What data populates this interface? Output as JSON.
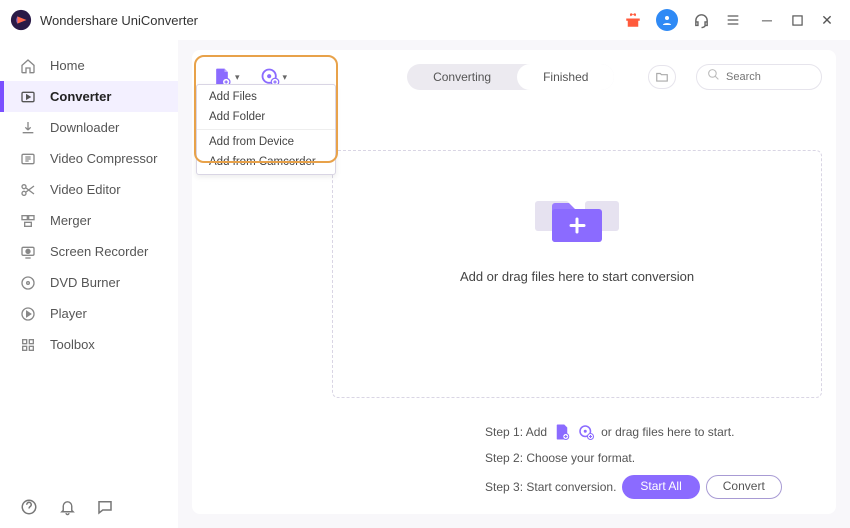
{
  "app_title": "Wondershare UniConverter",
  "titlebar_icons": {
    "gift": "gift-icon",
    "user": "user-icon",
    "support": "headset-icon",
    "menu": "hamburger-icon",
    "minimize": "minimize-icon",
    "maximize": "maximize-icon",
    "close": "close-icon"
  },
  "sidebar": {
    "items": [
      {
        "label": "Home",
        "icon": "home-icon"
      },
      {
        "label": "Converter",
        "icon": "converter-icon",
        "active": true
      },
      {
        "label": "Downloader",
        "icon": "download-icon"
      },
      {
        "label": "Video Compressor",
        "icon": "compress-icon"
      },
      {
        "label": "Video Editor",
        "icon": "scissors-icon"
      },
      {
        "label": "Merger",
        "icon": "merge-icon"
      },
      {
        "label": "Screen Recorder",
        "icon": "record-icon"
      },
      {
        "label": "DVD Burner",
        "icon": "disc-icon"
      },
      {
        "label": "Player",
        "icon": "play-icon"
      },
      {
        "label": "Toolbox",
        "icon": "grid-icon"
      }
    ],
    "bottom": [
      "help-icon",
      "bell-icon",
      "chat-icon"
    ]
  },
  "toolbar": {
    "add_file_icon": "add-file-icon",
    "add_source_icon": "add-source-icon"
  },
  "dropdown": {
    "add_files": "Add Files",
    "add_folder": "Add Folder",
    "add_device": "Add from Device",
    "add_camcorder": "Add from Camcorder"
  },
  "tabs": {
    "converting": "Converting",
    "finished": "Finished"
  },
  "search_placeholder": "Search",
  "dropzone": {
    "text": "Add or drag files here to start conversion"
  },
  "steps": {
    "s1_prefix": "Step 1: Add",
    "s1_suffix": "or drag files here to start.",
    "s2": "Step 2: Choose your format.",
    "s3": "Step 3: Start conversion.",
    "start_all": "Start All",
    "convert": "Convert"
  }
}
